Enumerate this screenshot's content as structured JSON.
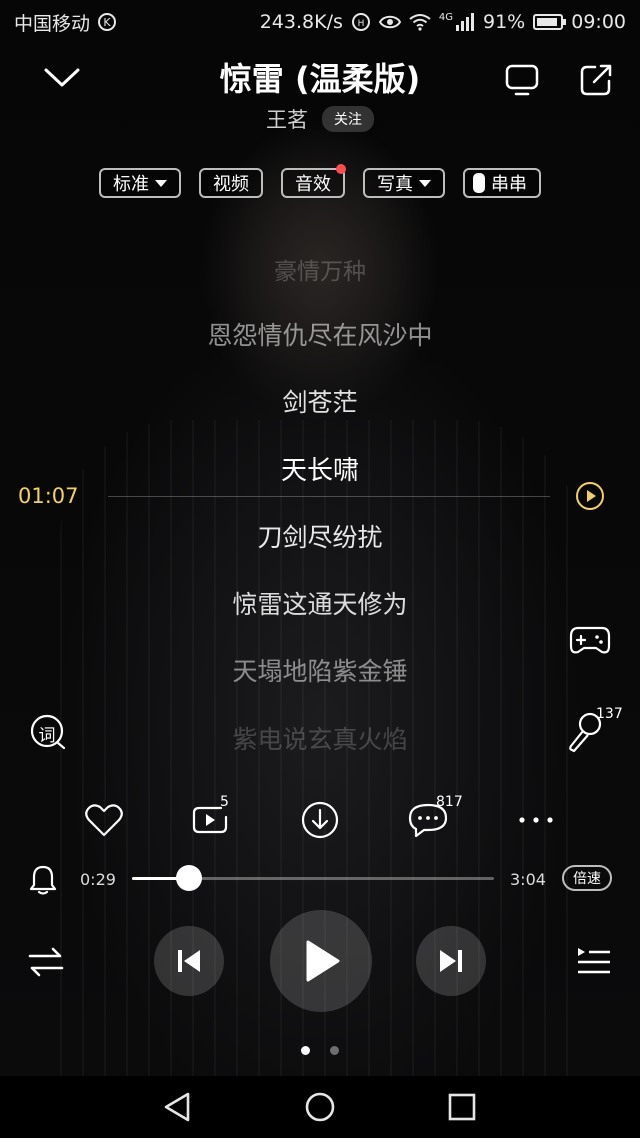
{
  "status": {
    "carrier": "中国移动",
    "carrier_badge": "K",
    "speed": "243.8K/s",
    "network": "4G",
    "battery": "91%",
    "battery_level": 0.91,
    "time": "09:00"
  },
  "header": {
    "title": "惊雷 (温柔版)",
    "artist": "王茗",
    "follow_label": "关注"
  },
  "chips": [
    {
      "label": "标准",
      "dropdown": true
    },
    {
      "label": "视频"
    },
    {
      "label": "音效",
      "dot": true
    },
    {
      "label": "写真",
      "dropdown": true
    },
    {
      "label": "串串",
      "switch": true
    }
  ],
  "lyrics": [
    {
      "text": "豪情万种",
      "state": "faded"
    },
    {
      "text": "恩怨情仇尽在风沙中",
      "state": "dim"
    },
    {
      "text": "剑苍茫",
      "state": "normal"
    },
    {
      "text": "天长啸",
      "state": "active"
    },
    {
      "text": "刀剑尽纷扰",
      "state": "normal"
    },
    {
      "text": "惊雷这通天修为",
      "state": "normal"
    },
    {
      "text": "天塌地陷紫金锤",
      "state": "dim"
    },
    {
      "text": "紫电说玄真火焰",
      "state": "faded"
    }
  ],
  "timeline": {
    "current": "01:07"
  },
  "side": {
    "lyrics_icon_label": "词",
    "karaoke_count": "137"
  },
  "actions": {
    "mv_count": "5",
    "comment_count": "817"
  },
  "playback": {
    "elapsed": "0:29",
    "duration": "3:04",
    "progress": 0.158,
    "speed_label": "倍速"
  },
  "pager": {
    "pages": 2,
    "active": 0
  }
}
